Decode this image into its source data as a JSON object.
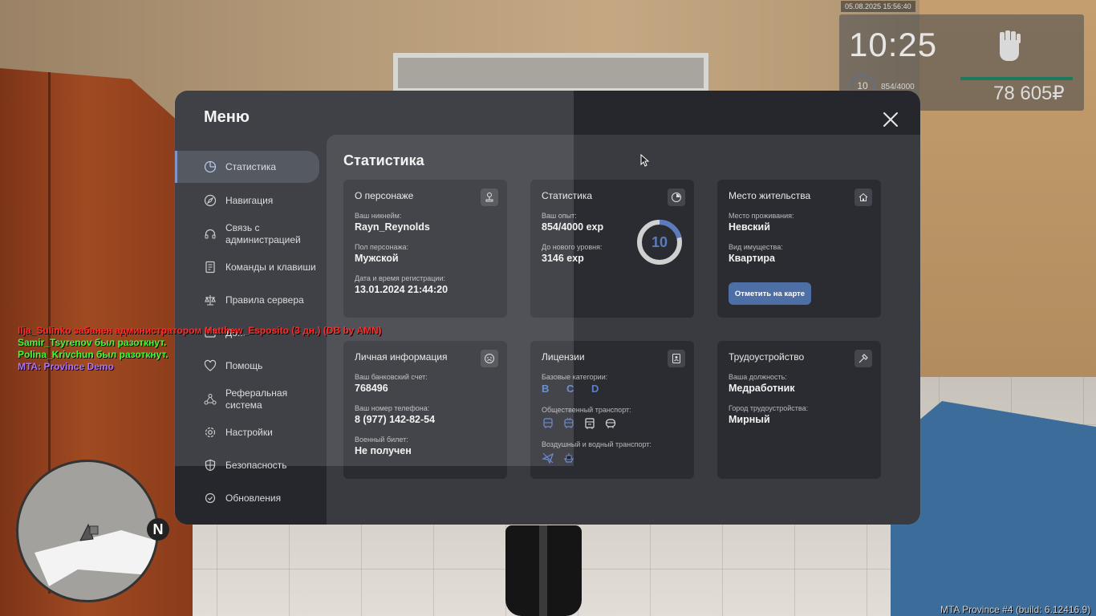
{
  "hud": {
    "datetime": "05.08.2025 15:56:40",
    "time": "10:25",
    "level": "10",
    "exp": "854/4000",
    "money": "78 605₽"
  },
  "chat": [
    {
      "text": "Ilja_Sulinko забанен администратором Matthew_Esposito (3 дн.) (DB by AMN)",
      "color": "#ff2a2a"
    },
    {
      "text": "Samir_Tsyrenov был разоткнут.",
      "color": "#3cff3c"
    },
    {
      "text": "Polina_Krivchun был разоткнут.",
      "color": "#3cff3c"
    },
    {
      "text": "MTA: Province Demo",
      "color": "#b070ff"
    }
  ],
  "minimap": {
    "north": "N"
  },
  "build": "MTA Province #4 (build: 6.12416.9)",
  "menu": {
    "title": "Меню",
    "sidebar": [
      {
        "label": "Статистика",
        "icon": "pie-chart-icon"
      },
      {
        "label": "Навигация",
        "icon": "compass-icon"
      },
      {
        "label": "Связь с\nадминистрацией",
        "icon": "headset-icon"
      },
      {
        "label": "Команды и клавиши",
        "icon": "document-icon"
      },
      {
        "label": "Правила сервера",
        "icon": "scales-icon"
      },
      {
        "label": "До...",
        "icon": "donate-icon"
      },
      {
        "label": "Помощь",
        "icon": "heart-icon"
      },
      {
        "label": "Реферальная\nсистема",
        "icon": "referral-icon"
      },
      {
        "label": "Настройки",
        "icon": "gear-icon"
      },
      {
        "label": "Безопасность",
        "icon": "shield-icon"
      },
      {
        "label": "Обновления",
        "icon": "refresh-icon"
      }
    ],
    "content_title": "Статистика",
    "character": {
      "title": "О персонаже",
      "nick_label": "Ваш никнейм:",
      "nick": "Rayn_Reynolds",
      "gender_label": "Пол персонажа:",
      "gender": "Мужской",
      "reg_label": "Дата и время регистрации:",
      "reg": "13.01.2024 21:44:20"
    },
    "stats": {
      "title": "Статистика",
      "exp_label": "Ваш опыт:",
      "exp": "854/4000 exp",
      "next_label": "До нового уровня:",
      "next": "3146 exp",
      "level": "10",
      "progress": 0.2135
    },
    "residence": {
      "title": "Место жительства",
      "place_label": "Место проживания:",
      "place": "Невский",
      "prop_label": "Вид имущества:",
      "prop": "Квартира",
      "button": "Отметить на карте"
    },
    "personal": {
      "title": "Личная информация",
      "bank_label": "Ваш банковский счет:",
      "bank": "768496",
      "phone_label": "Ваш номер телефона:",
      "phone": "8 (977) 142-82-54",
      "military_label": "Военный билет:",
      "military": "Не получен"
    },
    "licenses": {
      "title": "Лицензии",
      "base_label": "Базовые категории:",
      "base": "B C D",
      "public_label": "Общественный транспорт:",
      "air_label": "Воздушный и водный транспорт:"
    },
    "job": {
      "title": "Трудоустройство",
      "position_label": "Ваша должность:",
      "position": "Медработник",
      "city_label": "Город трудоустройства:",
      "city": "Мирный"
    },
    "accent": "#6f86c2"
  }
}
